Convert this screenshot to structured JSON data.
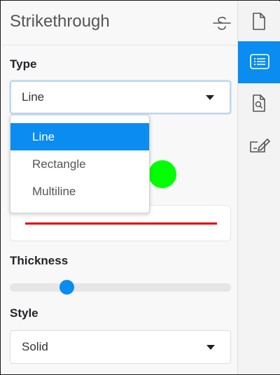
{
  "panel": {
    "title": "Strikethrough",
    "title_icon": "strikethrough-icon"
  },
  "type_field": {
    "label": "Type",
    "value": "Line",
    "options": [
      "Line",
      "Rectangle",
      "Multiline"
    ],
    "selected_index": 0
  },
  "color": {
    "swatch_color": "#00ff00"
  },
  "preview": {
    "line_color": "#e00000"
  },
  "thickness": {
    "label": "Thickness",
    "slider_value_fraction": 0.24
  },
  "style_field": {
    "label": "Style",
    "value": "Solid"
  },
  "sidebar": {
    "items": [
      {
        "icon": "document-icon",
        "active": false
      },
      {
        "icon": "list-icon",
        "active": true
      },
      {
        "icon": "document-search-icon",
        "active": false
      },
      {
        "icon": "edit-signature-icon",
        "active": false
      }
    ]
  },
  "colors": {
    "accent": "#0a8cf0",
    "panel_bg": "#f8f8f8"
  }
}
